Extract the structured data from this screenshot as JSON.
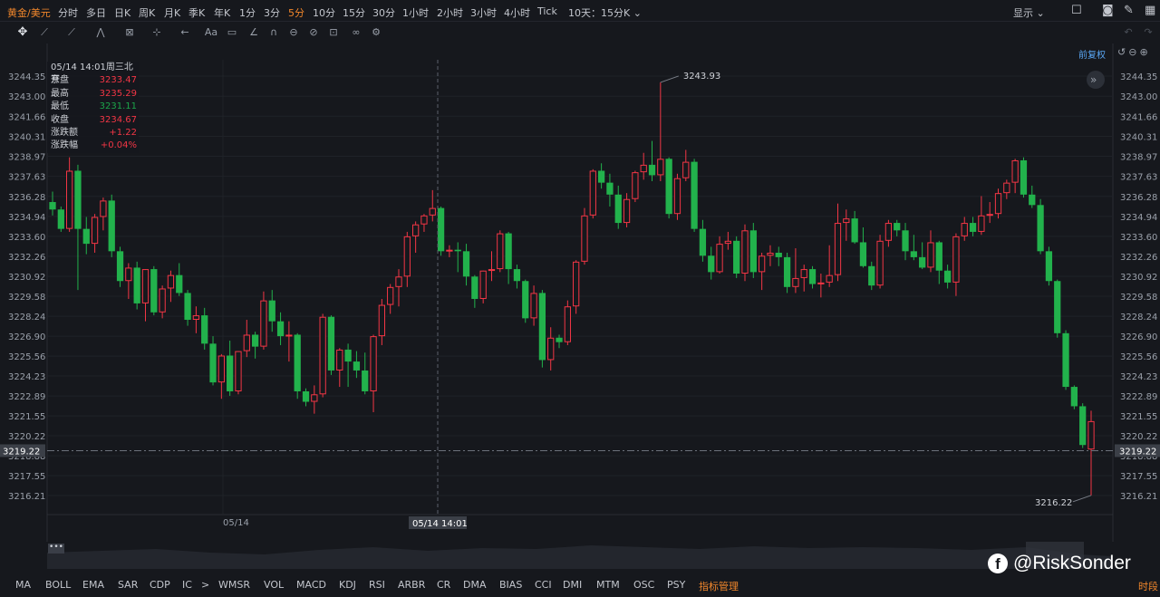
{
  "topbar": {
    "symbol": "黄金/美元",
    "timeframes": [
      "分时",
      "多日",
      "日K",
      "周K",
      "月K",
      "季K",
      "年K",
      "1分",
      "3分",
      "5分",
      "10分",
      "15分",
      "30分",
      "1小时",
      "2小时",
      "3小时",
      "4小时",
      "Tick"
    ],
    "active": "5分",
    "range_select": "10天：15分K",
    "display": "显示"
  },
  "toolbar": {
    "tools": [
      "move-icon",
      "line-icon",
      "ray-icon",
      "channel-icon",
      "pattern-icon",
      "measure-icon",
      "arrow-icon",
      "text-icon",
      "comment-icon",
      "brush-icon",
      "magnet-icon",
      "hide-icon",
      "lock-icon",
      "trash-icon",
      "link-icon",
      "settings-icon"
    ],
    "text_tool": "Aa"
  },
  "restore_label": "前复权",
  "ohlc": {
    "datetime": "05/14 14:01周三北京",
    "rows": [
      {
        "label": "开盘",
        "value": "3233.47",
        "color": "#f23645"
      },
      {
        "label": "最高",
        "value": "3235.29",
        "color": "#f23645"
      },
      {
        "label": "最低",
        "value": "3231.11",
        "color": "#1ca54a"
      },
      {
        "label": "收盘",
        "value": "3234.67",
        "color": "#f23645"
      },
      {
        "label": "涨跌额",
        "value": "+1.22",
        "color": "#f23645"
      },
      {
        "label": "涨跌幅",
        "value": "+0.04%",
        "color": "#f23645"
      }
    ]
  },
  "chart_data": {
    "type": "candlestick",
    "ylim": [
      3215.4,
      3245.2
    ],
    "yticks": [
      "3244.35",
      "3243.00",
      "3241.66",
      "3240.31",
      "3238.97",
      "3237.63",
      "3236.28",
      "3234.94",
      "3233.60",
      "3232.26",
      "3230.92",
      "3229.58",
      "3228.24",
      "3226.90",
      "3225.56",
      "3224.23",
      "3222.89",
      "3221.55",
      "3220.22",
      "3218.88",
      "3217.55",
      "3216.21"
    ],
    "current_price": "3219.22",
    "x_label": "05/14",
    "crosshair_label": "05/14 14:01",
    "annotations": [
      {
        "text": "3243.93",
        "value": 3243.93
      },
      {
        "text": "3216.22",
        "value": 3216.22
      }
    ],
    "up_color": "#f23645",
    "down_color": "#22b24c",
    "candles": [
      [
        3235.9,
        3236.6,
        3235.0,
        3235.4
      ],
      [
        3235.4,
        3235.6,
        3233.9,
        3234.1
      ],
      [
        3234.1,
        3238.9,
        3233.9,
        3238.0
      ],
      [
        3238.0,
        3238.4,
        3230.0,
        3234.1
      ],
      [
        3234.1,
        3234.9,
        3232.4,
        3233.1
      ],
      [
        3233.1,
        3235.1,
        3232.5,
        3234.9
      ],
      [
        3234.9,
        3236.2,
        3234.0,
        3236.0
      ],
      [
        3236.0,
        3236.4,
        3232.2,
        3232.6
      ],
      [
        3232.6,
        3232.9,
        3230.2,
        3230.6
      ],
      [
        3230.6,
        3231.8,
        3229.4,
        3231.5
      ],
      [
        3231.5,
        3231.9,
        3228.7,
        3229.1
      ],
      [
        3229.1,
        3231.4,
        3227.9,
        3231.4
      ],
      [
        3231.4,
        3231.6,
        3228.3,
        3228.5
      ],
      [
        3228.5,
        3230.3,
        3228.1,
        3230.1
      ],
      [
        3230.1,
        3231.3,
        3229.2,
        3231.0
      ],
      [
        3231.0,
        3231.8,
        3229.6,
        3229.8
      ],
      [
        3229.8,
        3230.0,
        3227.6,
        3228.0
      ],
      [
        3228.0,
        3228.9,
        3227.1,
        3228.3
      ],
      [
        3228.3,
        3228.8,
        3226.0,
        3226.4
      ],
      [
        3226.4,
        3226.9,
        3223.6,
        3223.8
      ],
      [
        3223.8,
        3225.7,
        3222.7,
        3225.6
      ],
      [
        3225.6,
        3226.6,
        3222.9,
        3223.2
      ],
      [
        3223.2,
        3225.9,
        3223.0,
        3225.9
      ],
      [
        3225.9,
        3228.0,
        3225.5,
        3227.0
      ],
      [
        3227.0,
        3227.2,
        3225.4,
        3226.2
      ],
      [
        3226.2,
        3229.9,
        3226.0,
        3229.3
      ],
      [
        3229.3,
        3230.0,
        3227.2,
        3227.9
      ],
      [
        3227.9,
        3228.5,
        3226.3,
        3226.9
      ],
      [
        3226.9,
        3227.9,
        3225.2,
        3227.0
      ],
      [
        3227.0,
        3227.1,
        3222.7,
        3223.2
      ],
      [
        3223.2,
        3223.4,
        3222.2,
        3222.5
      ],
      [
        3222.5,
        3223.6,
        3221.7,
        3223.0
      ],
      [
        3223.0,
        3228.4,
        3222.8,
        3228.2
      ],
      [
        3228.2,
        3228.3,
        3224.3,
        3224.6
      ],
      [
        3224.6,
        3226.1,
        3223.5,
        3226.0
      ],
      [
        3226.0,
        3226.4,
        3223.5,
        3225.2
      ],
      [
        3225.2,
        3225.9,
        3224.1,
        3224.6
      ],
      [
        3224.6,
        3225.8,
        3223.0,
        3223.2
      ],
      [
        3223.2,
        3227.0,
        3221.8,
        3226.9
      ],
      [
        3226.9,
        3229.4,
        3226.3,
        3229.0
      ],
      [
        3229.0,
        3230.4,
        3228.4,
        3230.2
      ],
      [
        3230.2,
        3231.4,
        3228.9,
        3230.9
      ],
      [
        3230.9,
        3233.9,
        3230.2,
        3233.6
      ],
      [
        3233.6,
        3234.6,
        3232.5,
        3234.4
      ],
      [
        3234.4,
        3235.1,
        3233.9,
        3235.0
      ],
      [
        3235.0,
        3236.7,
        3234.6,
        3235.5
      ],
      [
        3235.5,
        3235.6,
        3232.3,
        3232.6
      ],
      [
        3232.6,
        3233.0,
        3232.2,
        3232.7
      ],
      [
        3232.7,
        3233.2,
        3231.2,
        3232.6
      ],
      [
        3232.6,
        3233.1,
        3230.3,
        3230.9
      ],
      [
        3230.9,
        3231.0,
        3228.8,
        3229.4
      ],
      [
        3229.4,
        3231.3,
        3229.1,
        3231.3
      ],
      [
        3231.3,
        3232.6,
        3230.6,
        3231.4
      ],
      [
        3231.4,
        3234.0,
        3231.2,
        3233.8
      ],
      [
        3233.8,
        3233.9,
        3230.4,
        3231.4
      ],
      [
        3231.4,
        3231.7,
        3230.1,
        3230.6
      ],
      [
        3230.6,
        3230.7,
        3227.8,
        3228.1
      ],
      [
        3228.1,
        3230.3,
        3227.6,
        3229.8
      ],
      [
        3229.8,
        3230.0,
        3224.8,
        3225.3
      ],
      [
        3225.3,
        3227.5,
        3224.6,
        3226.8
      ],
      [
        3226.8,
        3227.0,
        3226.1,
        3226.5
      ],
      [
        3226.5,
        3229.3,
        3226.3,
        3228.9
      ],
      [
        3228.9,
        3232.0,
        3228.4,
        3231.9
      ],
      [
        3231.9,
        3235.5,
        3231.7,
        3235.0
      ],
      [
        3235.0,
        3238.1,
        3234.8,
        3238.0
      ],
      [
        3238.0,
        3238.5,
        3236.8,
        3237.2
      ],
      [
        3237.2,
        3237.8,
        3235.6,
        3236.4
      ],
      [
        3236.4,
        3237.0,
        3234.1,
        3234.5
      ],
      [
        3234.5,
        3236.5,
        3234.2,
        3236.1
      ],
      [
        3236.1,
        3238.0,
        3235.9,
        3237.9
      ],
      [
        3237.9,
        3239.2,
        3237.4,
        3238.4
      ],
      [
        3238.4,
        3240.0,
        3237.3,
        3237.7
      ],
      [
        3237.7,
        3243.93,
        3237.3,
        3238.8
      ],
      [
        3238.8,
        3238.9,
        3234.8,
        3235.1
      ],
      [
        3235.1,
        3237.8,
        3234.7,
        3237.5
      ],
      [
        3237.5,
        3239.4,
        3237.3,
        3238.6
      ],
      [
        3238.6,
        3238.8,
        3233.9,
        3234.1
      ],
      [
        3234.1,
        3234.7,
        3231.9,
        3232.3
      ],
      [
        3232.3,
        3232.9,
        3230.7,
        3231.2
      ],
      [
        3231.2,
        3233.6,
        3231.1,
        3233.1
      ],
      [
        3233.1,
        3233.9,
        3232.7,
        3233.3
      ],
      [
        3233.3,
        3233.6,
        3230.8,
        3231.1
      ],
      [
        3231.1,
        3234.4,
        3230.6,
        3234.0
      ],
      [
        3234.0,
        3234.5,
        3230.8,
        3231.2
      ],
      [
        3231.2,
        3232.5,
        3230.0,
        3232.3
      ],
      [
        3232.3,
        3233.0,
        3231.6,
        3232.5
      ],
      [
        3232.5,
        3232.9,
        3231.6,
        3232.2
      ],
      [
        3232.2,
        3232.5,
        3229.8,
        3230.2
      ],
      [
        3230.2,
        3232.8,
        3229.8,
        3230.8
      ],
      [
        3230.8,
        3231.7,
        3229.9,
        3231.4
      ],
      [
        3231.4,
        3231.6,
        3230.1,
        3230.4
      ],
      [
        3230.4,
        3231.1,
        3229.5,
        3230.5
      ],
      [
        3230.5,
        3233.0,
        3230.2,
        3231.0
      ],
      [
        3231.0,
        3235.8,
        3230.6,
        3234.5
      ],
      [
        3234.5,
        3235.4,
        3233.3,
        3234.8
      ],
      [
        3234.8,
        3235.3,
        3233.1,
        3233.2
      ],
      [
        3233.2,
        3234.2,
        3231.5,
        3231.6
      ],
      [
        3231.6,
        3231.9,
        3230.0,
        3230.3
      ],
      [
        3230.3,
        3233.7,
        3230.1,
        3233.3
      ],
      [
        3233.3,
        3234.7,
        3232.9,
        3234.5
      ],
      [
        3234.5,
        3234.7,
        3233.6,
        3234.0
      ],
      [
        3234.0,
        3234.5,
        3232.0,
        3232.6
      ],
      [
        3232.6,
        3233.7,
        3232.0,
        3232.2
      ],
      [
        3232.2,
        3233.2,
        3231.4,
        3231.5
      ],
      [
        3231.5,
        3234.0,
        3231.2,
        3233.2
      ],
      [
        3233.2,
        3233.3,
        3230.4,
        3231.3
      ],
      [
        3231.3,
        3231.7,
        3230.1,
        3230.5
      ],
      [
        3230.5,
        3233.8,
        3229.6,
        3233.6
      ],
      [
        3233.6,
        3234.9,
        3233.3,
        3234.5
      ],
      [
        3234.5,
        3234.9,
        3233.6,
        3233.9
      ],
      [
        3233.9,
        3236.3,
        3233.7,
        3235.0
      ],
      [
        3235.0,
        3235.9,
        3234.5,
        3235.1
      ],
      [
        3235.1,
        3236.8,
        3234.8,
        3236.5
      ],
      [
        3236.5,
        3237.4,
        3236.1,
        3237.2
      ],
      [
        3237.2,
        3238.8,
        3236.5,
        3238.7
      ],
      [
        3238.7,
        3238.9,
        3236.2,
        3236.4
      ],
      [
        3236.4,
        3237.0,
        3235.5,
        3235.7
      ],
      [
        3235.7,
        3236.1,
        3232.4,
        3232.6
      ],
      [
        3232.6,
        3232.9,
        3230.3,
        3230.6
      ],
      [
        3230.6,
        3230.7,
        3226.8,
        3227.1
      ],
      [
        3227.1,
        3227.3,
        3223.3,
        3223.5
      ],
      [
        3223.5,
        3223.6,
        3222.0,
        3222.2
      ],
      [
        3222.2,
        3222.4,
        3219.4,
        3219.6
      ],
      [
        3219.3,
        3221.9,
        3216.22,
        3221.2
      ]
    ]
  },
  "indicators": [
    "MA",
    "BOLL",
    "EMA",
    "SAR",
    "CDP",
    "IC",
    ">",
    "WMSR",
    "VOL",
    "MACD",
    "KDJ",
    "RSI",
    "ARBR",
    "CR",
    "DMA",
    "BIAS",
    "CCI",
    "DMI",
    "MTM",
    "OSC",
    "PSY",
    "指标管理"
  ],
  "indicator_highlight": "指标管理",
  "period_label": "时段",
  "watermark": "@RiskSonder"
}
